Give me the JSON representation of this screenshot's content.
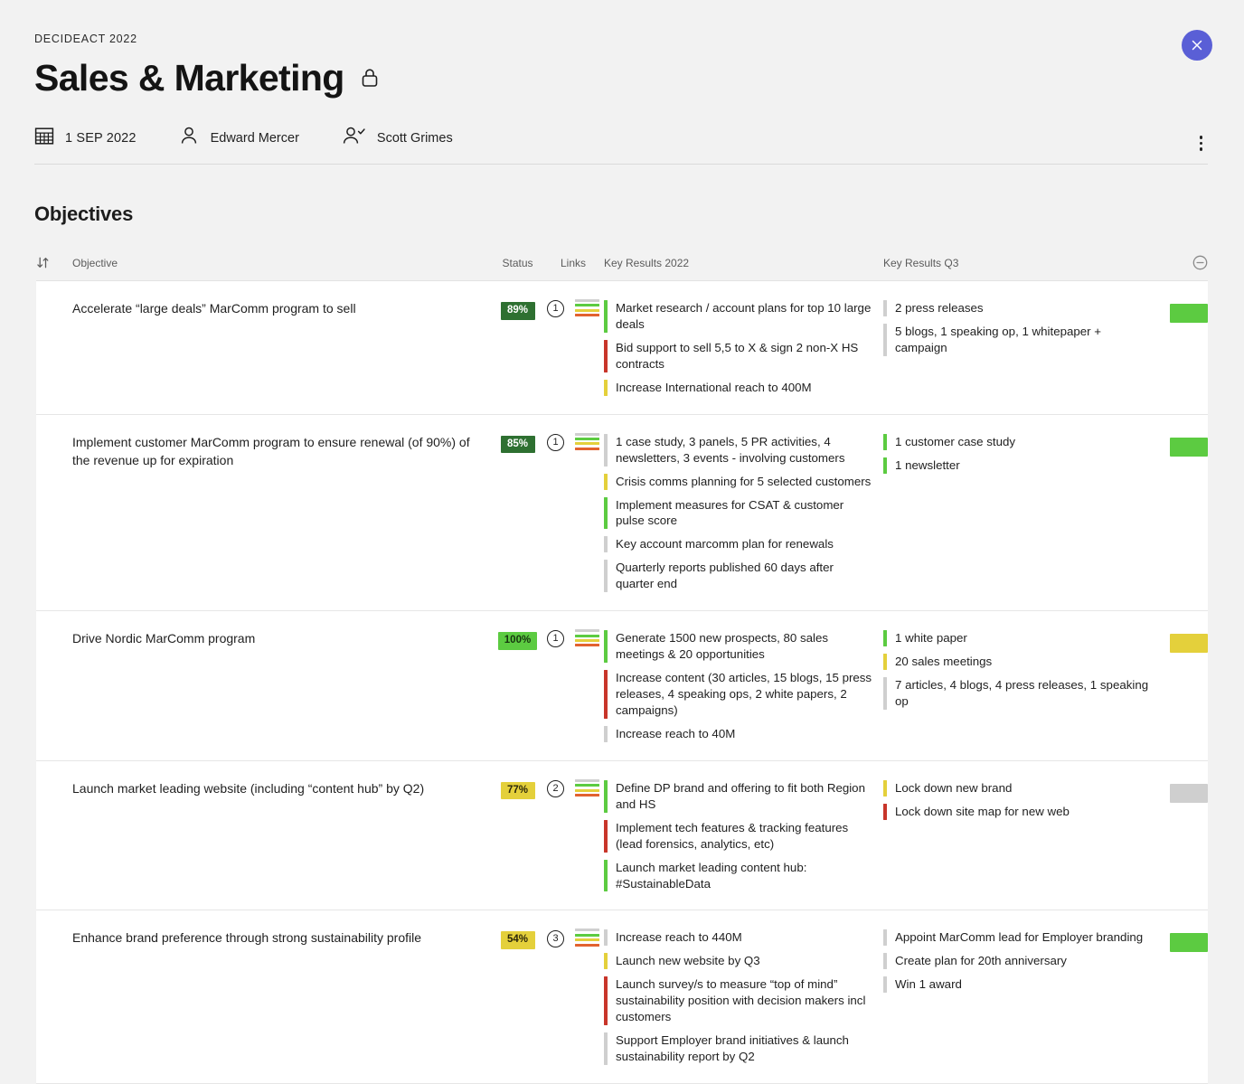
{
  "header": {
    "eyebrow": "DECIDEACT 2022",
    "title": "Sales & Marketing",
    "lock_icon": "lock-icon",
    "close_icon": "close-icon",
    "close_color": "#5a5fd6"
  },
  "meta": {
    "calendar_icon": "calendar-icon",
    "date": "1 SEP 2022",
    "owner_icon": "person-icon",
    "owner": "Edward Mercer",
    "approver_icon": "person-check-icon",
    "approver": "Scott Grimes",
    "more_icon": "kebab-menu-icon"
  },
  "section": {
    "title": "Objectives"
  },
  "table": {
    "sort_icon": "sort-icon",
    "collapse_icon": "collapse-circle-minus-icon",
    "columns": {
      "objective": "Objective",
      "status": "Status",
      "links": "Links",
      "kr2022": "Key Results 2022",
      "kr_q3": "Key Results Q3"
    },
    "link_bars": [
      "#cfcfcf",
      "#5ccb41",
      "#e4d03b",
      "#e2622f"
    ],
    "status_colors": {
      "green_dark": "#2e7031",
      "green": "#5ccb41",
      "yellow": "#e4d03b",
      "gray": "#cfcfcf",
      "red": "#c8352a"
    },
    "rows": [
      {
        "objective": "Accelerate “large deals” MarComm program to sell",
        "status": "89%",
        "status_style": "green-dark",
        "links": "1",
        "chip_color": "#5ccb41",
        "kr2022": [
          {
            "text": "Market research / account plans for top 10 large deals",
            "color": "#5ccb41"
          },
          {
            "text": "Bid support to sell 5,5 to X & sign 2 non-X HS contracts",
            "color": "#c8352a"
          },
          {
            "text": "Increase International reach to 400M",
            "color": "#e4d03b"
          }
        ],
        "kr_q3": [
          {
            "text": "2 press releases",
            "color": "#cfcfcf"
          },
          {
            "text": "5 blogs, 1 speaking op, 1 whitepaper + campaign",
            "color": "#cfcfcf"
          }
        ]
      },
      {
        "objective": "Implement customer MarComm program to ensure renewal (of 90%) of the revenue up for expiration",
        "status": "85%",
        "status_style": "green-dark",
        "links": "1",
        "chip_color": "#5ccb41",
        "kr2022": [
          {
            "text": "1 case study, 3 panels, 5 PR activities, 4 newsletters, 3 events - involving customers",
            "color": "#cfcfcf"
          },
          {
            "text": "Crisis comms planning for 5 selected customers",
            "color": "#e4d03b"
          },
          {
            "text": "Implement measures for CSAT & customer pulse score",
            "color": "#5ccb41"
          },
          {
            "text": "Key account marcomm plan for renewals",
            "color": "#cfcfcf"
          },
          {
            "text": "Quarterly reports published 60 days after quarter end",
            "color": "#cfcfcf"
          }
        ],
        "kr_q3": [
          {
            "text": "1 customer case study",
            "color": "#5ccb41"
          },
          {
            "text": "1 newsletter",
            "color": "#5ccb41"
          }
        ]
      },
      {
        "objective": "Drive Nordic MarComm program",
        "status": "100%",
        "status_style": "green",
        "links": "1",
        "chip_color": "#e4d03b",
        "kr2022": [
          {
            "text": "Generate 1500 new prospects, 80 sales meetings & 20 opportunities",
            "color": "#5ccb41"
          },
          {
            "text": "Increase content (30 articles, 15 blogs, 15 press releases, 4 speaking ops, 2 white papers, 2 campaigns)",
            "color": "#c8352a"
          },
          {
            "text": "Increase reach to 40M",
            "color": "#cfcfcf"
          }
        ],
        "kr_q3": [
          {
            "text": "1 white paper",
            "color": "#5ccb41"
          },
          {
            "text": "20 sales meetings",
            "color": "#e4d03b"
          },
          {
            "text": "7 articles, 4 blogs, 4 press releases, 1 speaking op",
            "color": "#cfcfcf"
          }
        ]
      },
      {
        "objective": "Launch market leading website (including “content hub” by Q2)",
        "status": "77%",
        "status_style": "yellow",
        "links": "2",
        "chip_color": "#cfcfcf",
        "kr2022": [
          {
            "text": "Define DP brand and offering to fit both Region and HS",
            "color": "#5ccb41"
          },
          {
            "text": "Implement tech features & tracking features (lead forensics, analytics, etc)",
            "color": "#c8352a"
          },
          {
            "text": "Launch market leading content hub: #SustainableData",
            "color": "#5ccb41"
          }
        ],
        "kr_q3": [
          {
            "text": "Lock down new brand",
            "color": "#e4d03b"
          },
          {
            "text": "Lock down site map for new web",
            "color": "#c8352a"
          }
        ]
      },
      {
        "objective": "Enhance brand preference through strong sustainability profile",
        "status": "54%",
        "status_style": "yellow",
        "links": "3",
        "chip_color": "#5ccb41",
        "kr2022": [
          {
            "text": "Increase reach to 440M",
            "color": "#cfcfcf"
          },
          {
            "text": "Launch new website by Q3",
            "color": "#e4d03b"
          },
          {
            "text": "Launch survey/s to measure “top of mind” sustainability position with decision makers incl customers",
            "color": "#c8352a"
          },
          {
            "text": "Support Employer brand initiatives & launch sustainability report by Q2",
            "color": "#cfcfcf"
          }
        ],
        "kr_q3": [
          {
            "text": "Appoint MarComm lead for Employer branding",
            "color": "#cfcfcf"
          },
          {
            "text": "Create plan for 20th anniversary",
            "color": "#cfcfcf"
          },
          {
            "text": "Win 1 award",
            "color": "#cfcfcf"
          }
        ]
      }
    ]
  }
}
